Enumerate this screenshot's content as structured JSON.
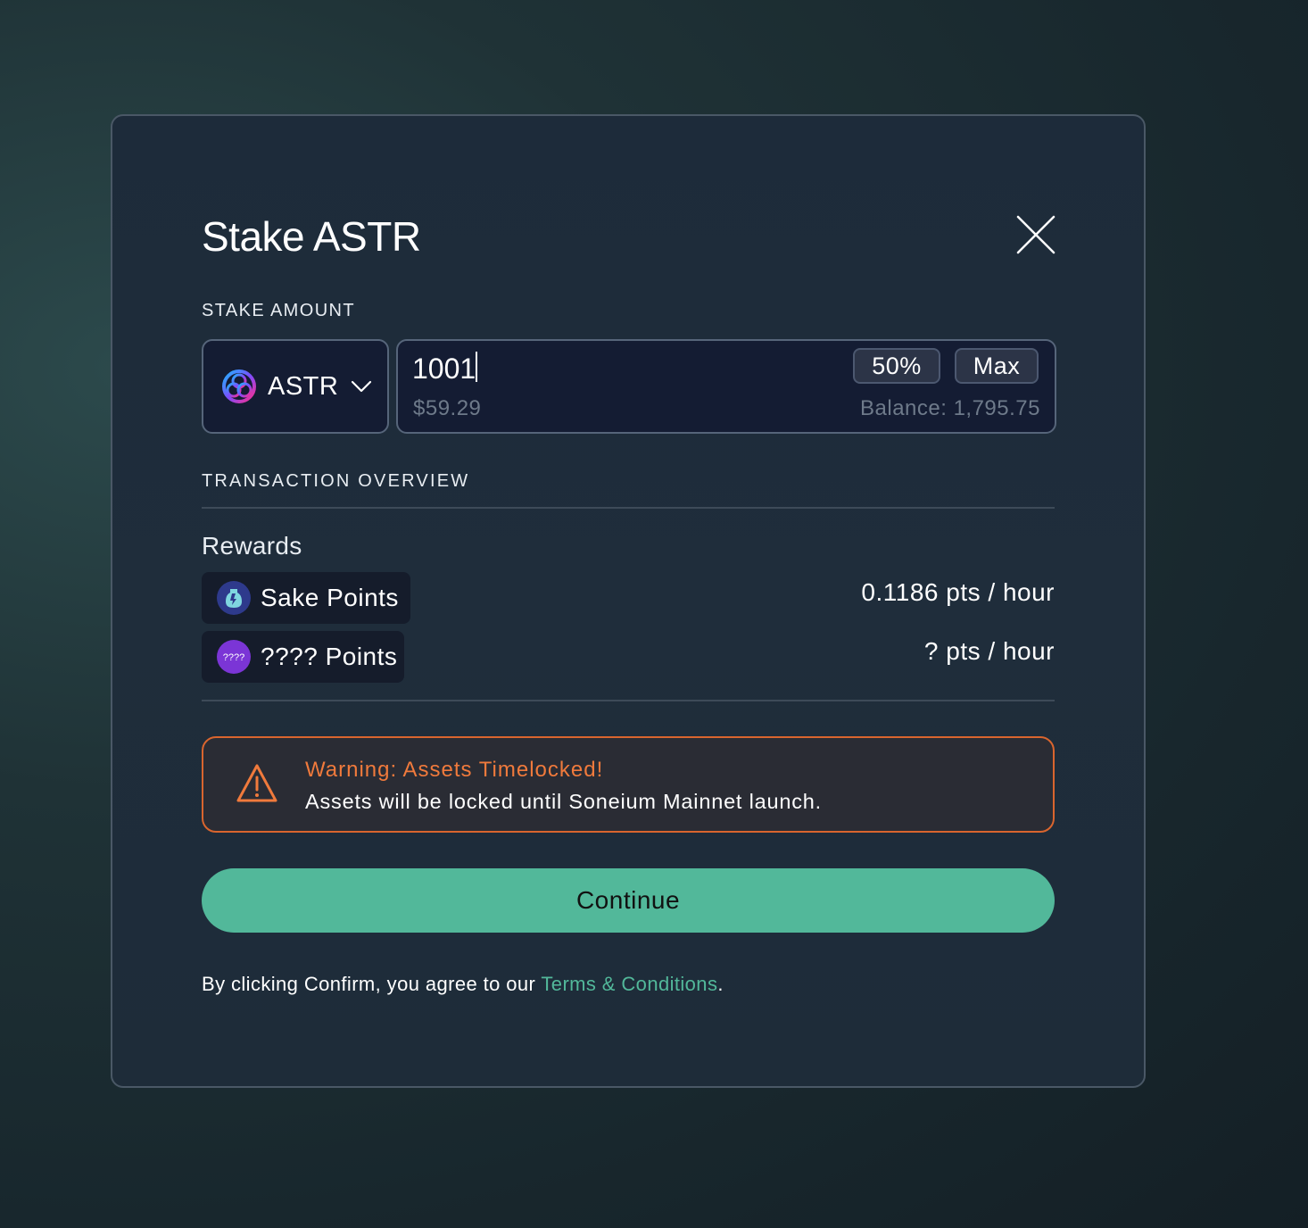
{
  "modal": {
    "title": "Stake ASTR",
    "stake_amount_label": "STAKE AMOUNT",
    "token": {
      "symbol": "ASTR"
    },
    "amount": {
      "value": "1001",
      "usd": "$59.29",
      "balance": "Balance: 1,795.75",
      "half_label": "50%",
      "max_label": "Max"
    },
    "overview_label": "TRANSACTION OVERVIEW",
    "rewards": {
      "label": "Rewards",
      "items": [
        {
          "name": "Sake Points",
          "rate": "0.1186 pts / hour"
        },
        {
          "name": "???? Points",
          "rate": "? pts / hour",
          "icon_text": "????"
        }
      ]
    },
    "warning": {
      "title": "Warning: Assets Timelocked!",
      "text": "Assets will be locked until Soneium Mainnet launch."
    },
    "continue_label": "Continue",
    "terms": {
      "prefix": "By clicking Confirm, you agree to our ",
      "link": "Terms & Conditions",
      "suffix": "."
    }
  },
  "colors": {
    "accent": "#52b89a",
    "warning": "#d9652e",
    "warning_text": "#f07a3c",
    "mystery_icon": "#7b35d6",
    "sake_icon": "#2e3a8c"
  },
  "icons": [
    "close-icon",
    "astr-token-icon",
    "chevron-down-icon",
    "sake-icon",
    "mystery-points-icon",
    "warning-triangle-icon"
  ]
}
